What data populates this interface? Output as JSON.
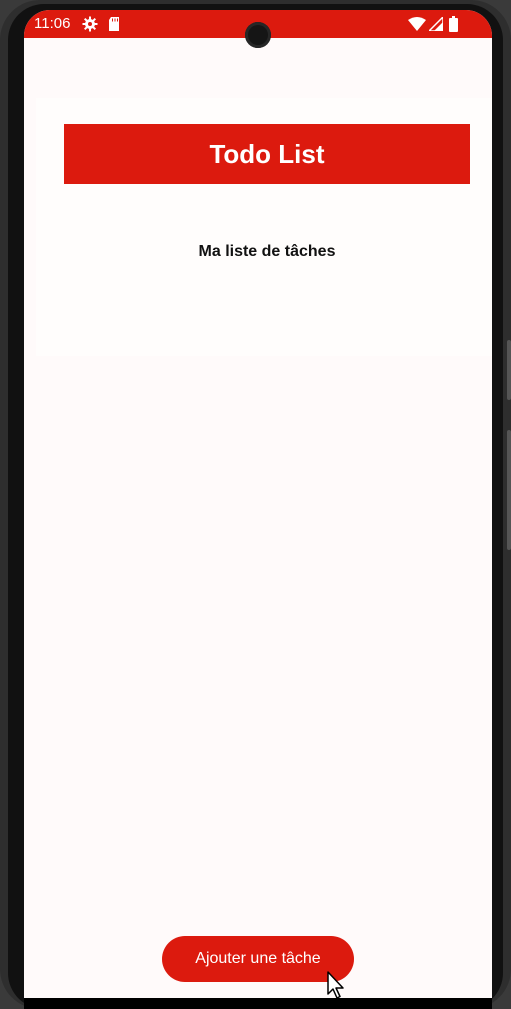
{
  "status_bar": {
    "time": "11:06",
    "icons": [
      "gear-icon",
      "sd-card-icon",
      "wifi-icon",
      "signal-icon",
      "battery-icon"
    ],
    "background_color": "#dc1a0e"
  },
  "header": {
    "title": "Todo List",
    "subtitle": "Ma liste de tâches"
  },
  "actions": {
    "add_task_label": "Ajouter une tâche"
  },
  "colors": {
    "accent": "#dc1a0e",
    "background": "#fffafa",
    "text": "#111111"
  }
}
